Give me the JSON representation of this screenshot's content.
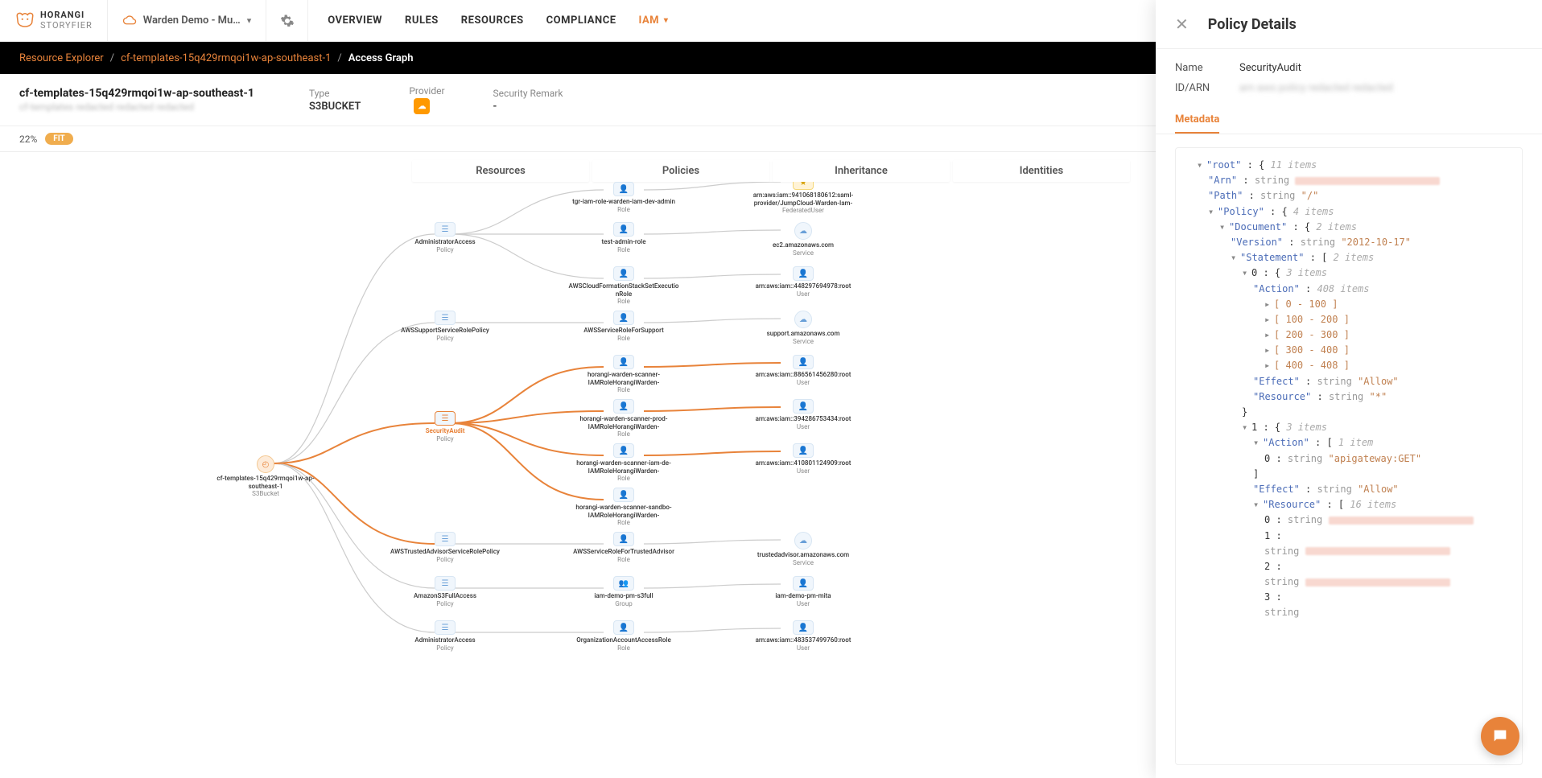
{
  "brand": "HORANGI",
  "brand_sub": "STORYFIER",
  "workspace": {
    "label": "Warden Demo - Mu…"
  },
  "nav": {
    "overview": "OVERVIEW",
    "rules": "RULES",
    "resources": "RESOURCES",
    "compliance": "COMPLIANCE",
    "iam": "IAM"
  },
  "breadcrumb": {
    "root": "Resource Explorer",
    "mid": "cf-templates-15q429rmqoi1w-ap-southeast-1",
    "leaf": "Access Graph"
  },
  "summary": {
    "title": "cf-templates-15q429rmqoi1w-ap-southeast-1",
    "type_label": "Type",
    "type_value": "S3BUCKET",
    "provider_label": "Provider",
    "remark_label": "Security Remark",
    "remark_value": "-"
  },
  "fitbar": {
    "zoom": "22%",
    "fit": "FIT"
  },
  "graph_cols": {
    "c1": "Resources",
    "c2": "Policies",
    "c3": "Inheritance",
    "c4": "Identities"
  },
  "nodes": {
    "root": {
      "label": "cf-templates-15q429rmqoi1w-ap-southeast-1",
      "type": "S3Bucket"
    },
    "p1": {
      "label": "AdministratorAccess",
      "type": "Policy"
    },
    "p2": {
      "label": "AWSSupportServiceRolePolicy",
      "type": "Policy"
    },
    "p3": {
      "label": "SecurityAudit",
      "type": "Policy"
    },
    "p4": {
      "label": "AWSTrustedAdvisorServiceRolePolicy",
      "type": "Policy"
    },
    "p5": {
      "label": "AmazonS3FullAccess",
      "type": "Policy"
    },
    "p6": {
      "label": "AdministratorAccess",
      "type": "Policy"
    },
    "r1": {
      "label": "tgr-iam-role-warden-iam-dev-admin",
      "type": "Role"
    },
    "r2": {
      "label": "test-admin-role",
      "type": "Role"
    },
    "r3": {
      "label": "AWSCloudFormationStackSetExecutionRole",
      "type": "Role"
    },
    "r4": {
      "label": "AWSServiceRoleForSupport",
      "type": "Role"
    },
    "r5": {
      "label": "horangi-warden-scanner-IAMRoleHorangiWarden-",
      "type": "Role"
    },
    "r6": {
      "label": "horangi-warden-scanner-prod-IAMRoleHorangiWarden-",
      "type": "Role"
    },
    "r7": {
      "label": "horangi-warden-scanner-iam-de-IAMRoleHorangiWarden-",
      "type": "Role"
    },
    "r8": {
      "label": "horangi-warden-scanner-sandbo-IAMRoleHorangiWarden-",
      "type": "Role"
    },
    "r9": {
      "label": "AWSServiceRoleForTrustedAdvisor",
      "type": "Role"
    },
    "r10": {
      "label": "iam-demo-pm-s3full",
      "type": "Group"
    },
    "r11": {
      "label": "OrganizationAccountAccessRole",
      "type": "Role"
    },
    "i1": {
      "label": "arn:aws:iam::941068180612:saml-provider/JumpCloud-Warden-Iam-",
      "type": "FederatedUser"
    },
    "i2": {
      "label": "ec2.amazonaws.com",
      "type": "Service"
    },
    "i3": {
      "label": "arn:aws:iam::448297694978:root",
      "type": "User"
    },
    "i4": {
      "label": "support.amazonaws.com",
      "type": "Service"
    },
    "i5": {
      "label": "arn:aws:iam::886561456280:root",
      "type": "User"
    },
    "i6": {
      "label": "arn:aws:iam::394286753434:root",
      "type": "User"
    },
    "i7": {
      "label": "arn:aws:iam::410801124909:root",
      "type": "User"
    },
    "i9": {
      "label": "trustedadvisor.amazonaws.com",
      "type": "Service"
    },
    "i10": {
      "label": "iam-demo-pm-mita",
      "type": "User"
    },
    "i11": {
      "label": "arn:aws:iam::483537499760:root",
      "type": "User"
    }
  },
  "panel": {
    "title": "Policy Details",
    "name_label": "Name",
    "name_value": "SecurityAudit",
    "arn_label": "ID/ARN",
    "tab": "Metadata",
    "json": {
      "root_count": "11 items",
      "arn_type": "string",
      "path_type": "string",
      "path_val": "\"/\"",
      "policy_count": "4 items",
      "document_count": "2 items",
      "version_type": "string",
      "version_val": "\"2012-10-17\"",
      "statement_count": "2 items",
      "s0_count": "3 items",
      "action0_count": "408 items",
      "r0": "[ 0 - 100 ]",
      "r1": "[ 100 - 200 ]",
      "r2": "[ 200 - 300 ]",
      "r3": "[ 300 - 400 ]",
      "r4": "[ 400 - 408 ]",
      "effect_type": "string",
      "effect_val": "\"Allow\"",
      "resource_type": "string",
      "resource_val": "\"*\"",
      "s1_count": "3 items",
      "action1_count": "1 item",
      "action1_item_type": "string",
      "action1_item_val": "\"apigateway:GET\"",
      "effect1_type": "string",
      "effect1_val": "\"Allow\"",
      "resource1_count": "16 items",
      "res_item_type": "string"
    }
  }
}
